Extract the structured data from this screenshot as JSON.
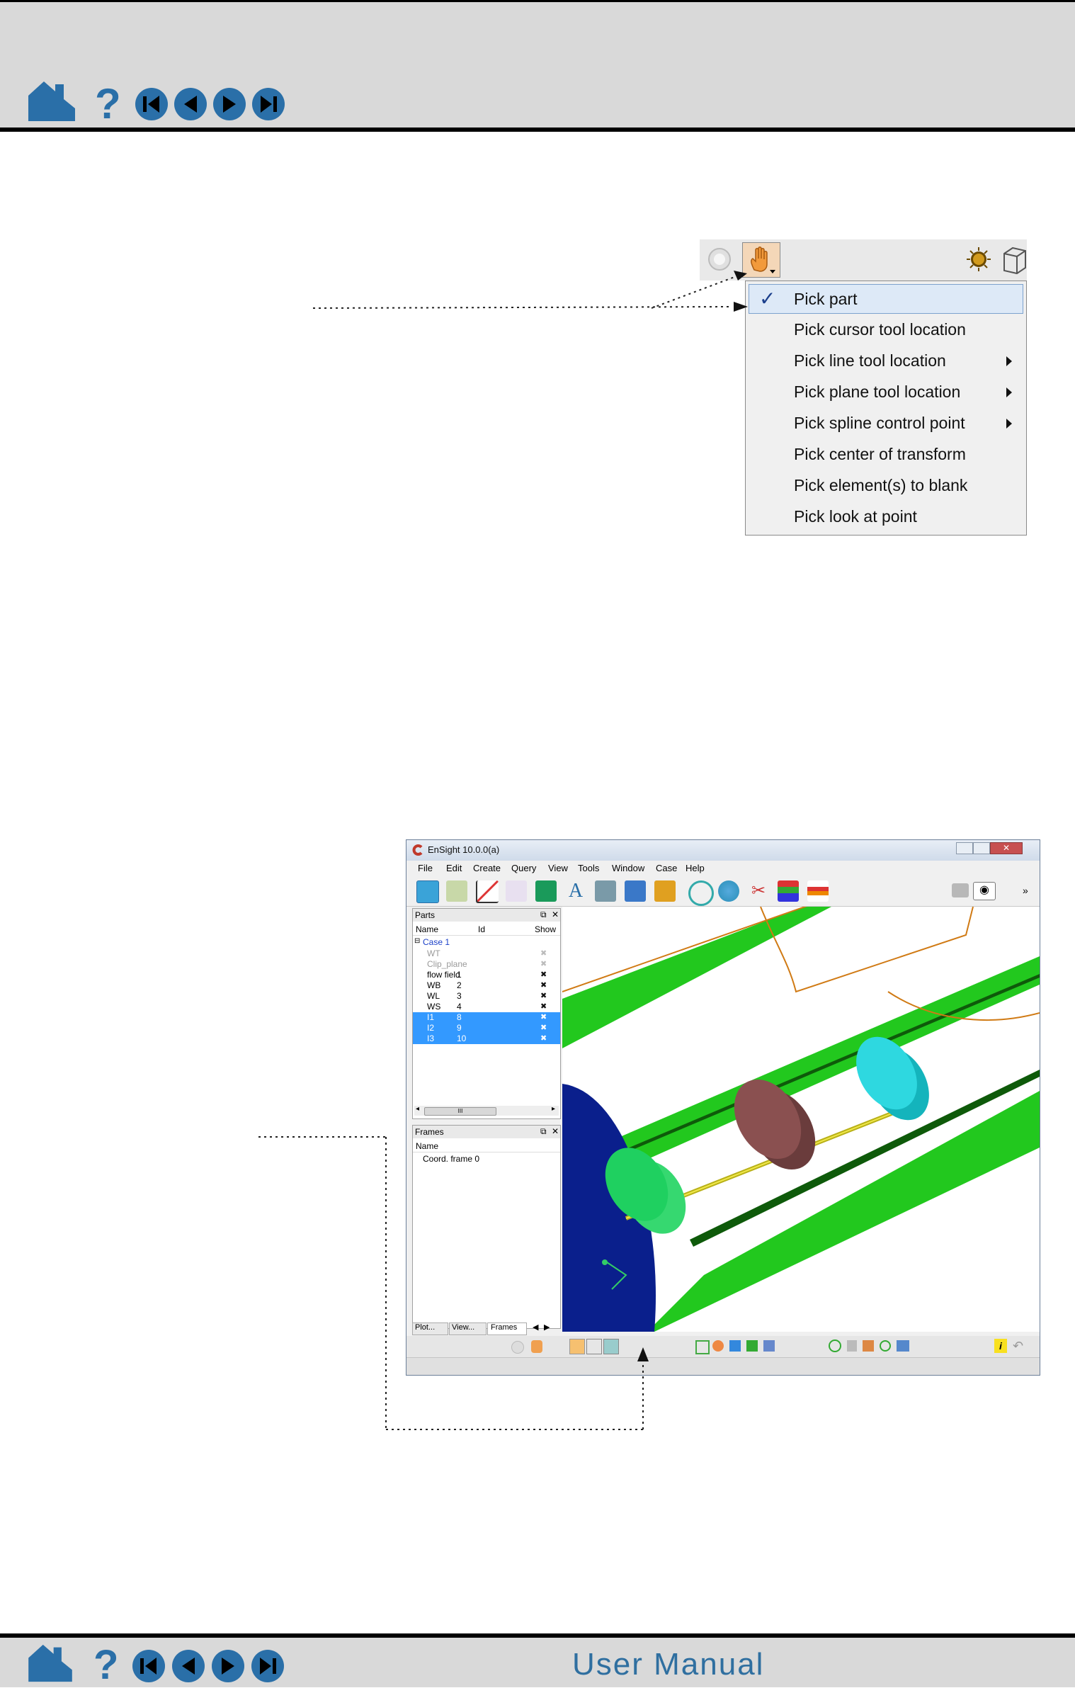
{
  "footer": {
    "title": "User Manual"
  },
  "pick_menu": {
    "items": [
      {
        "label": "Pick part",
        "checked": true,
        "submenu": false
      },
      {
        "label": "Pick cursor tool location",
        "checked": false,
        "submenu": false
      },
      {
        "label": "Pick line tool location",
        "checked": false,
        "submenu": true
      },
      {
        "label": "Pick plane tool location",
        "checked": false,
        "submenu": true
      },
      {
        "label": "Pick spline control point",
        "checked": false,
        "submenu": true
      },
      {
        "label": "Pick center of transform",
        "checked": false,
        "submenu": false
      },
      {
        "label": "Pick element(s) to blank",
        "checked": false,
        "submenu": false
      },
      {
        "label": "Pick look at point",
        "checked": false,
        "submenu": false
      }
    ],
    "check_glyph": "✓"
  },
  "ensight": {
    "title": "EnSight 10.0.0(a)",
    "menu": [
      "File",
      "Edit",
      "Create",
      "Query",
      "View",
      "Tools",
      "Window",
      "Case",
      "Help"
    ],
    "parts_panel": {
      "title": "Parts",
      "columns": [
        "Name",
        "Id",
        "Show"
      ],
      "case": "Case 1",
      "rows": [
        {
          "name": "WT",
          "id": "",
          "state": "dim",
          "selected": false
        },
        {
          "name": "Clip_plane",
          "id": "",
          "state": "dim",
          "selected": false
        },
        {
          "name": "flow field",
          "id": "1",
          "state": "normal",
          "selected": false
        },
        {
          "name": "WB",
          "id": "2",
          "state": "normal",
          "selected": false
        },
        {
          "name": "WL",
          "id": "3",
          "state": "normal",
          "selected": false
        },
        {
          "name": "WS",
          "id": "4",
          "state": "normal",
          "selected": false
        },
        {
          "name": "I1",
          "id": "8",
          "state": "normal",
          "selected": true
        },
        {
          "name": "I2",
          "id": "9",
          "state": "normal",
          "selected": true
        },
        {
          "name": "I3",
          "id": "10",
          "state": "normal",
          "selected": true
        }
      ],
      "scroll_grip": "III"
    },
    "frames_panel": {
      "title": "Frames",
      "column": "Name",
      "rows": [
        "Coord. frame 0"
      ]
    },
    "tabs": [
      "Plot...",
      "View...",
      "Frames"
    ],
    "colors": {
      "selection": "#3399ff",
      "green_part": "#22c81e",
      "cyan_disk": "#1ec8d2",
      "maroon_disk": "#7a4a4a",
      "navy": "#0a1f8c",
      "frame_line": "#d07a14"
    }
  }
}
